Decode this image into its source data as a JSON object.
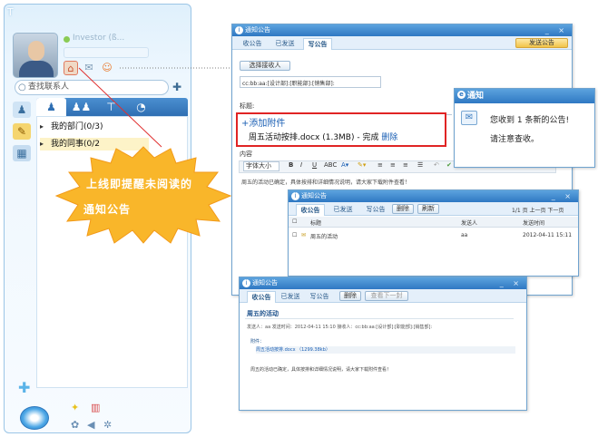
{
  "im": {
    "title": "T",
    "nickname": "Investor (ß...",
    "signature": "",
    "search_placeholder": "查找联系人",
    "groups": [
      {
        "name": "我的部门",
        "count": "(0/3)"
      },
      {
        "name": "我的同事",
        "count": "(0/2"
      }
    ]
  },
  "callout": {
    "line1": "上线即提醒未阅读的",
    "line2": "通知公告"
  },
  "compose": {
    "title": "通知公告",
    "tabs": [
      "收公告",
      "已发送",
      "写公告"
    ],
    "send_button": "发送公告",
    "select_recipients": "选择接收人",
    "recipients": "cc:bb:aa:[设计部]:[职能部]:[销售部]:",
    "subject_label": "标题:",
    "attach_title": "+添加附件",
    "attachment": "周五活动按排.docx (1.3MB) - 完成",
    "delete": "删除",
    "content_label": "内容",
    "font_size": "字体大小",
    "body": "周五的活动已确定，具体按排和详细情况说明，请大家下载附件查看！"
  },
  "toast": {
    "title": "通知",
    "line1": "您收到 1 条新的公告!",
    "line2": "请注意查收。"
  },
  "inbox": {
    "title": "通知公告",
    "tabs": [
      "收公告",
      "已发送",
      "写公告"
    ],
    "delete": "删除",
    "refresh": "刷新",
    "pager": "1/1 页  上一页  下一页",
    "col_title": "标题",
    "col_sender": "发送人",
    "col_time": "发送时间",
    "rows": [
      {
        "title": "周五的活动",
        "sender": "aa",
        "time": "2012-04-11 15:11"
      }
    ]
  },
  "detail": {
    "title": "通知公告",
    "tabs": [
      "收公告",
      "已发送",
      "写公告"
    ],
    "delete": "删除",
    "back": "查看下一封",
    "subject": "周五的活动",
    "meta": "发送人：aa   发送时间：2012-04-11 15:10   接收人：cc:bb:aa:[设计部]:[职能部]:[销售部]:",
    "attach_label": "附件：",
    "attachment": "周五活动按排.docx （1299.38kb）",
    "body": "周五的活动已确定，具体按排和详细情况说明，请大家下载附件查看！"
  }
}
